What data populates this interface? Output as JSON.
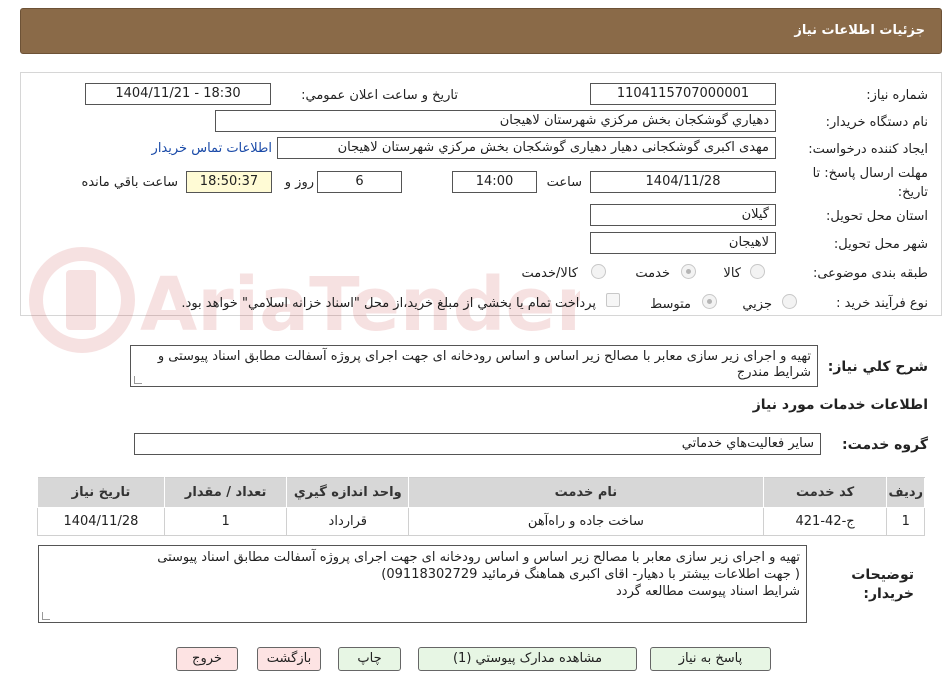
{
  "header": {
    "title": "جزئیات اطلاعات نیاز"
  },
  "form": {
    "need_number_label": "شماره نیاز:",
    "need_number": "1104115707000001",
    "announce_label": "تاریخ و ساعت اعلان عمومي:",
    "announce_value": "1404/11/21 - 18:30",
    "buyer_org_label": "نام دستگاه خريدار:",
    "buyer_org": "دهياري گوشكجان  بخش مركزي شهرستان لاهيجان",
    "creator_label": "ايجاد كننده درخواست:",
    "creator": "مهدی اکبری گوشکجانی دهیار دهیاری گوشكجان  بخش مركزي شهرستان لاهيجان",
    "contact_link": "اطلاعات تماس خريدار",
    "deadline_label_line1": "مهلت ارسال پاسخ: تا",
    "deadline_label_line2": "تاریخ:",
    "deadline_date": "1404/11/28",
    "time_label": "ساعت",
    "deadline_time": "14:00",
    "days_value": "6",
    "days_label": "روز و",
    "remaining_time": "18:50:37",
    "remaining_label": "ساعت باقي مانده",
    "province_label": "استان محل تحویل:",
    "province": "گيلان",
    "city_label": "شهر محل تحویل:",
    "city": "لاهيجان",
    "category_label": "طبقه بندی موضوعی:",
    "category_options": [
      "كالا",
      "خدمت",
      "كالا/خدمت"
    ],
    "category_selected": "خدمت",
    "process_label": "نوع فرآیند خرید :",
    "process_options": [
      "جزيي",
      "متوسط"
    ],
    "process_selected": "متوسط",
    "payment_note": "پرداخت تمام يا بخشي از مبلغ خريد،از محل \"اسناد خزانه اسلامي\" خواهد بود."
  },
  "description": {
    "label": "شرح كلي نياز:",
    "text": "تهیه و اجرای زیر سازی معابر با مصالح زیر اساس و اساس رودخانه ای جهت اجرای پروژه آسفالت مطابق اسناد پیوستی و شرایط مندرج"
  },
  "services": {
    "section_title": "اطلاعات خدمات مورد نياز",
    "group_label": "گروه خدمت:",
    "group_value": "ساير فعاليت‌هاي خدماتي",
    "columns": [
      "رديف",
      "كد خدمت",
      "نام خدمت",
      "واحد اندازه گيري",
      "تعداد / مقدار",
      "تاريخ نياز"
    ],
    "rows": [
      [
        "1",
        "ج-42-421",
        "ساخت جاده و راه‌آهن",
        "قرارداد",
        "1",
        "1404/11/28"
      ]
    ]
  },
  "buyer_notes": {
    "label_line1": "توضيحات",
    "label_line2": "خريدار:",
    "lines": [
      "تهیه و اجرای زیر سازی معابر با مصالح زیر اساس و اساس رودخانه ای جهت اجرای پروژه آسفالت مطابق اسناد پیوستی",
      "( جهت اطلاعات بیشتر با دهیار- اقای اکبری هماهنگ فرمائید 09118302729)",
      "شرایط اسناد پیوست مطالعه گردد"
    ]
  },
  "buttons": {
    "reply": "پاسخ به نياز",
    "view_docs": "مشاهده مدارک پيوستي (1)",
    "print": "چاپ",
    "back": "بازگشت",
    "exit": "خروج"
  },
  "watermark": {
    "text": "AriaTender.neT"
  },
  "colors": {
    "header_bg": "#8a6a48",
    "link": "#1a4aa8",
    "remaining_bg": "#fffbd5",
    "button_green": "#e7f6e4",
    "button_red": "#fde3e3"
  }
}
